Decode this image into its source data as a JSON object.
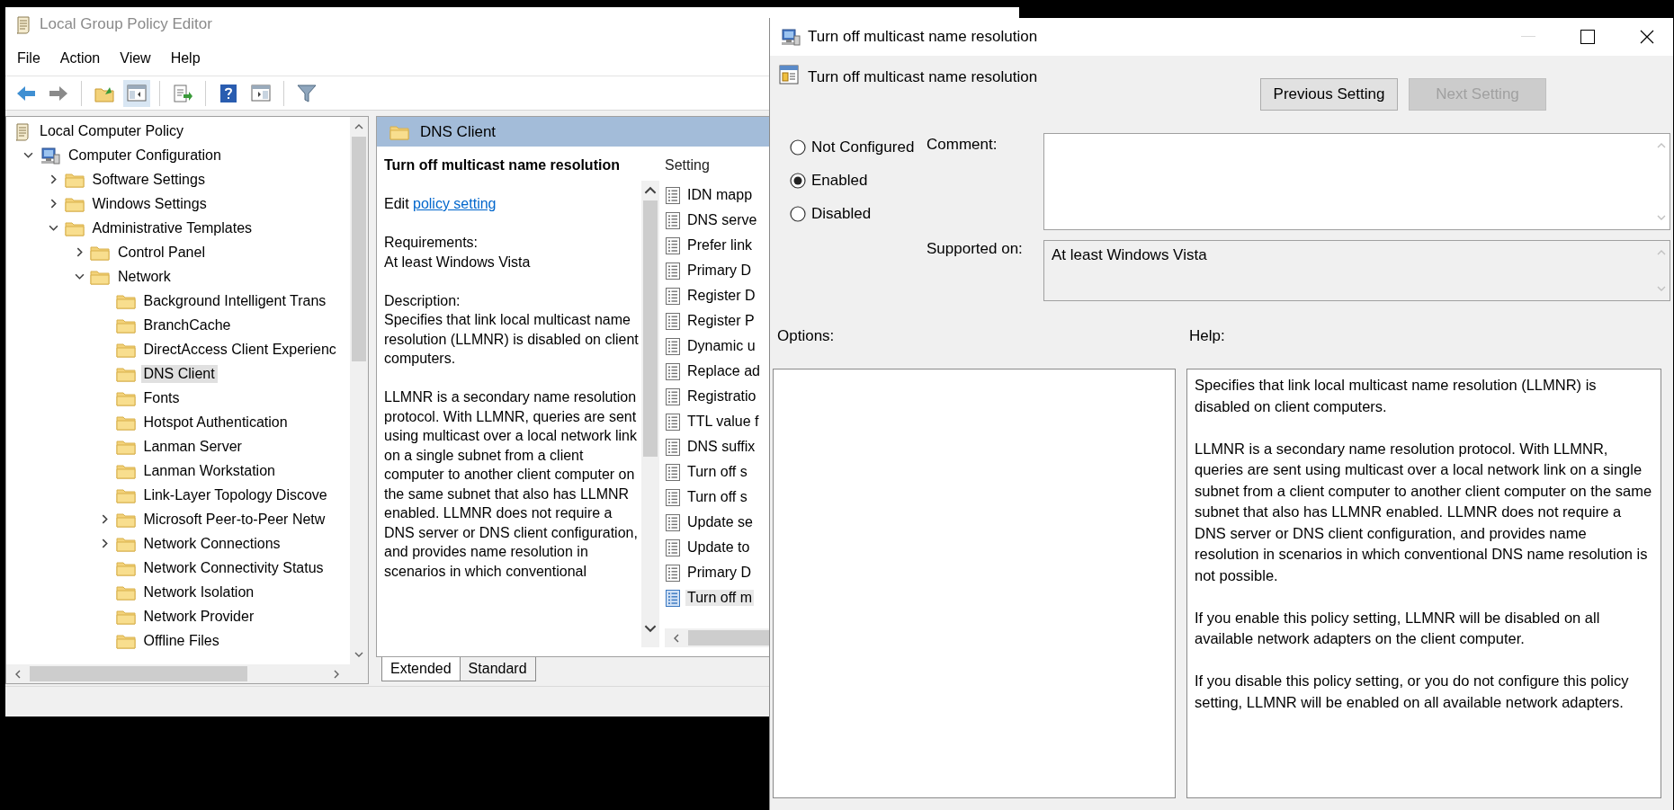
{
  "main_window": {
    "title": "Local Group Policy Editor",
    "menu": [
      "File",
      "Action",
      "View",
      "Help"
    ],
    "tree": [
      {
        "label": "Local Computer Policy",
        "kind": "policy",
        "selected": false,
        "children": [
          {
            "label": "Computer Configuration",
            "kind": "computer",
            "selected": false,
            "expanded": true,
            "children": [
              {
                "label": "Software Settings",
                "kind": "folder",
                "selected": false,
                "expanded": false
              },
              {
                "label": "Windows Settings",
                "kind": "folder",
                "selected": false,
                "expanded": false
              },
              {
                "label": "Administrative Templates",
                "kind": "folder",
                "selected": false,
                "expanded": true,
                "children": [
                  {
                    "label": "Control Panel",
                    "kind": "folder",
                    "selected": false,
                    "expanded": false
                  },
                  {
                    "label": "Network",
                    "kind": "folder",
                    "selected": false,
                    "expanded": true,
                    "children": [
                      {
                        "label": "Background Intelligent Trans",
                        "kind": "folder",
                        "selected": false
                      },
                      {
                        "label": "BranchCache",
                        "kind": "folder",
                        "selected": false
                      },
                      {
                        "label": "DirectAccess Client Experienc",
                        "kind": "folder",
                        "selected": false
                      },
                      {
                        "label": "DNS Client",
                        "kind": "folder",
                        "selected": true
                      },
                      {
                        "label": "Fonts",
                        "kind": "folder",
                        "selected": false
                      },
                      {
                        "label": "Hotspot Authentication",
                        "kind": "folder",
                        "selected": false
                      },
                      {
                        "label": "Lanman Server",
                        "kind": "folder",
                        "selected": false
                      },
                      {
                        "label": "Lanman Workstation",
                        "kind": "folder",
                        "selected": false
                      },
                      {
                        "label": "Link-Layer Topology Discove",
                        "kind": "folder",
                        "selected": false
                      },
                      {
                        "label": "Microsoft Peer-to-Peer Netw",
                        "kind": "folder",
                        "selected": false,
                        "expanded": false
                      },
                      {
                        "label": "Network Connections",
                        "kind": "folder",
                        "selected": false,
                        "expanded": false
                      },
                      {
                        "label": "Network Connectivity Status",
                        "kind": "folder",
                        "selected": false
                      },
                      {
                        "label": "Network Isolation",
                        "kind": "folder",
                        "selected": false
                      },
                      {
                        "label": "Network Provider",
                        "kind": "folder",
                        "selected": false
                      },
                      {
                        "label": "Offline Files",
                        "kind": "folder",
                        "selected": false
                      }
                    ]
                  }
                ]
              }
            ]
          }
        ]
      }
    ],
    "details": {
      "header": "DNS Client",
      "policy_title": "Turn off multicast name resolution",
      "edit_prefix": "Edit",
      "edit_link": "policy setting",
      "requirements_label": "Requirements:",
      "requirements": "At least Windows Vista",
      "description_label": "Description:",
      "description_paragraphs": [
        "Specifies that link local multicast name resolution (LLMNR) is disabled on client computers.",
        "LLMNR is a secondary name resolution protocol. With LLMNR, queries are sent using multicast over a local network link on a single subnet from a client computer to another client computer on the same subnet that also has LLMNR enabled. LLMNR does not require a DNS server or DNS client configuration, and provides name resolution in scenarios in which conventional"
      ],
      "list_header": "Setting",
      "settings": [
        {
          "label": "IDN mapp",
          "selected": false
        },
        {
          "label": "DNS serve",
          "selected": false
        },
        {
          "label": "Prefer link",
          "selected": false
        },
        {
          "label": "Primary D",
          "selected": false
        },
        {
          "label": "Register D",
          "selected": false
        },
        {
          "label": "Register P",
          "selected": false
        },
        {
          "label": "Dynamic u",
          "selected": false
        },
        {
          "label": "Replace ad",
          "selected": false
        },
        {
          "label": "Registratio",
          "selected": false
        },
        {
          "label": "TTL value f",
          "selected": false
        },
        {
          "label": "DNS suffix",
          "selected": false
        },
        {
          "label": "Turn off s",
          "selected": false
        },
        {
          "label": "Turn off s",
          "selected": false
        },
        {
          "label": "Update se",
          "selected": false
        },
        {
          "label": "Update to",
          "selected": false
        },
        {
          "label": "Primary D",
          "selected": false
        },
        {
          "label": "Turn off m",
          "selected": true
        }
      ]
    },
    "view_tabs": [
      {
        "label": "Extended",
        "selected": true
      },
      {
        "label": "Standard",
        "selected": false
      }
    ]
  },
  "dialog": {
    "title": "Turn off multicast name resolution",
    "policy_name": "Turn off multicast name resolution",
    "buttons": [
      {
        "label": "Previous Setting",
        "disabled": false
      },
      {
        "label": "Next Setting",
        "disabled": true
      }
    ],
    "states": [
      {
        "label": "Not Configured",
        "selected": false
      },
      {
        "label": "Enabled",
        "selected": true
      },
      {
        "label": "Disabled",
        "selected": false
      }
    ],
    "comment_label": "Comment:",
    "supported_label": "Supported on:",
    "supported_value": "At least Windows Vista",
    "options_label": "Options:",
    "help_label": "Help:",
    "help_paragraphs": [
      "Specifies that link local multicast name resolution (LLMNR) is disabled on client computers.",
      "LLMNR is a secondary name resolution protocol. With LLMNR, queries are sent using multicast over a local network link on a single subnet from a client computer to another client computer on the same subnet that also has LLMNR enabled. LLMNR does not require a DNS server or DNS client configuration, and provides name resolution in scenarios in which conventional DNS name resolution is not possible.",
      "If you enable this policy setting, LLMNR will be disabled on all available network adapters on the client computer.",
      "If you disable this policy setting, or you do not configure this policy setting, LLMNR will be enabled on all available network adapters."
    ]
  }
}
